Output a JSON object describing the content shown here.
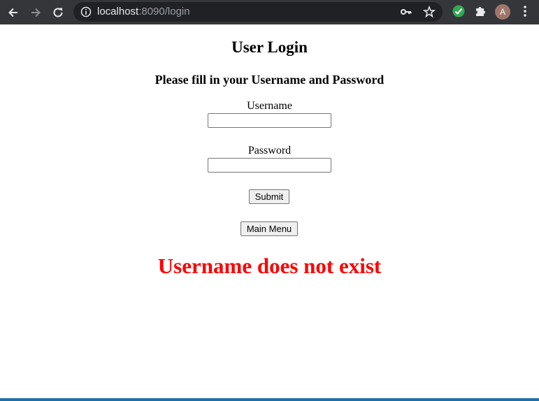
{
  "browser": {
    "url_host": "localhost",
    "url_rest": ":8090/login",
    "avatar_letter": "A"
  },
  "page": {
    "title": "User Login",
    "subtitle": "Please fill in your Username and Password",
    "username_label": "Username",
    "username_value": "",
    "password_label": "Password",
    "password_value": "",
    "submit_label": "Submit",
    "main_menu_label": "Main Menu",
    "error_message": "Username does not exist"
  },
  "colors": {
    "error": "#ff0000",
    "chrome_bg": "#35363a",
    "omnibox_bg": "#202124"
  },
  "icons": [
    "back-arrow-icon",
    "forward-arrow-icon",
    "reload-icon",
    "info-icon",
    "key-icon",
    "star-icon",
    "checkmark-extension-icon",
    "puzzle-extensions-icon",
    "kebab-menu-icon"
  ]
}
